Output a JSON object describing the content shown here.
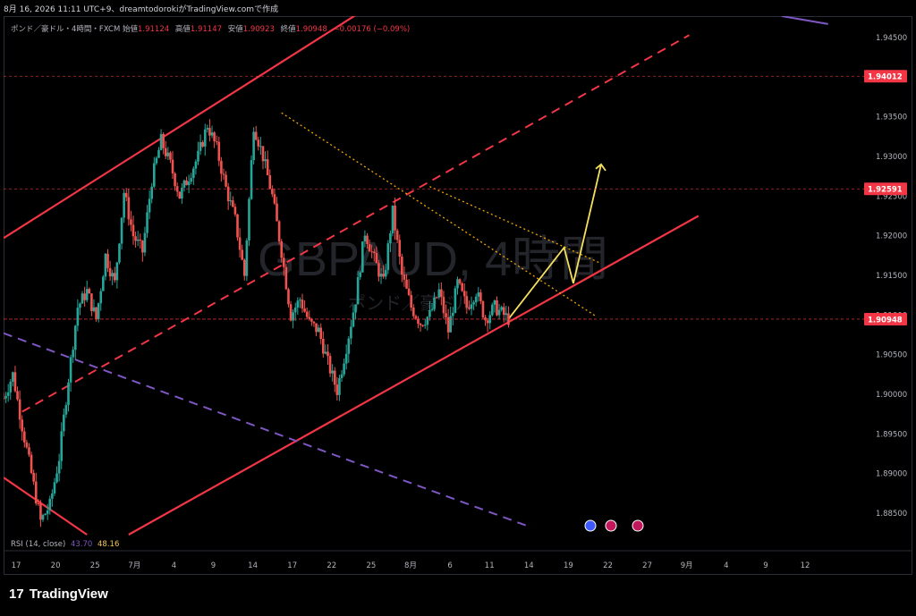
{
  "header": {
    "text": "8月 16, 2026 11:11 UTC+9、dreamtodorokiがTradingView.comで作成"
  },
  "legend": {
    "symbol": "ポンド／豪ドル・4時間・FXCM",
    "open_label": "始値",
    "open": "1.91124",
    "high_label": "高値",
    "high": "1.91147",
    "low_label": "安値",
    "low": "1.90923",
    "close_label": "終値",
    "close": "1.90948",
    "change": "−0.00176 (−0.09%)"
  },
  "watermark": {
    "main": "GBPAUD, 4時間",
    "sub": "ポンド／豪ドル"
  },
  "rsi": {
    "label": "RSI (14, close)",
    "v1": "43.70",
    "v2": "48.16"
  },
  "footer": {
    "brand": "TradingView",
    "logo": "17"
  },
  "chart_data": {
    "type": "line",
    "title": "",
    "y_ticks": [
      "1.94500",
      "1.94000",
      "1.93500",
      "1.93000",
      "1.92500",
      "1.92000",
      "1.91500",
      "1.91000",
      "1.90500",
      "1.90000",
      "1.89500",
      "1.89000",
      "1.88500"
    ],
    "x_ticks": [
      "17",
      "20",
      "25",
      "7月",
      "4",
      "9",
      "14",
      "17",
      "22",
      "25",
      "8月",
      "6",
      "11",
      "14",
      "19",
      "22",
      "27",
      "9月",
      "4",
      "9",
      "12"
    ],
    "price_labels": [
      {
        "value": "1.94012",
        "color": "#f23645"
      },
      {
        "value": "1.92591",
        "color": "#f23645"
      },
      {
        "value": "1.90948",
        "color": "#f23645"
      }
    ],
    "price_series": {
      "name": "",
      "points": [
        [
          0,
          1.8995
        ],
        [
          2,
          1.9025
        ],
        [
          4,
          1.896
        ],
        [
          6,
          1.89
        ],
        [
          8,
          1.884
        ],
        [
          10,
          1.886
        ],
        [
          12,
          1.892
        ],
        [
          14,
          1.902
        ],
        [
          16,
          1.911
        ],
        [
          18,
          1.913
        ],
        [
          20,
          1.9095
        ],
        [
          22,
          1.9175
        ],
        [
          24,
          1.914
        ],
        [
          26,
          1.9255
        ],
        [
          28,
          1.92
        ],
        [
          30,
          1.918
        ],
        [
          32,
          1.927
        ],
        [
          34,
          1.932
        ],
        [
          36,
          1.929
        ],
        [
          38,
          1.925
        ],
        [
          40,
          1.9275
        ],
        [
          42,
          1.93
        ],
        [
          44,
          1.934
        ],
        [
          46,
          1.931
        ],
        [
          48,
          1.926
        ],
        [
          50,
          1.922
        ],
        [
          52,
          1.915
        ],
        [
          54,
          1.934
        ],
        [
          56,
          1.93
        ],
        [
          58,
          1.925
        ],
        [
          60,
          1.918
        ],
        [
          62,
          1.91
        ],
        [
          64,
          1.912
        ],
        [
          66,
          1.909
        ],
        [
          68,
          1.908
        ],
        [
          70,
          1.904
        ],
        [
          72,
          1.9005
        ],
        [
          74,
          1.906
        ],
        [
          76,
          1.912
        ],
        [
          78,
          1.9205
        ],
        [
          80,
          1.917
        ],
        [
          82,
          1.914
        ],
        [
          84,
          1.923
        ],
        [
          86,
          1.915
        ],
        [
          88,
          1.911
        ],
        [
          90,
          1.909
        ],
        [
          92,
          1.91
        ],
        [
          94,
          1.913
        ],
        [
          96,
          1.908
        ],
        [
          98,
          1.914
        ],
        [
          100,
          1.911
        ],
        [
          102,
          1.913
        ],
        [
          104,
          1.9095
        ],
        [
          106,
          1.911
        ],
        [
          108,
          1.91
        ],
        [
          109,
          1.90948
        ]
      ]
    },
    "ylim": [
      1.8823,
      1.9477
    ],
    "xlim": [
      0,
      185
    ],
    "grid": false,
    "log_scale": false
  },
  "colors": {
    "background": "#000000",
    "channel": "#f23645",
    "purple": "#7e57c2",
    "projection": "#f6e05e",
    "trend_dotted": "#f0a500",
    "up": "#26a69a",
    "down": "#ef5350"
  }
}
